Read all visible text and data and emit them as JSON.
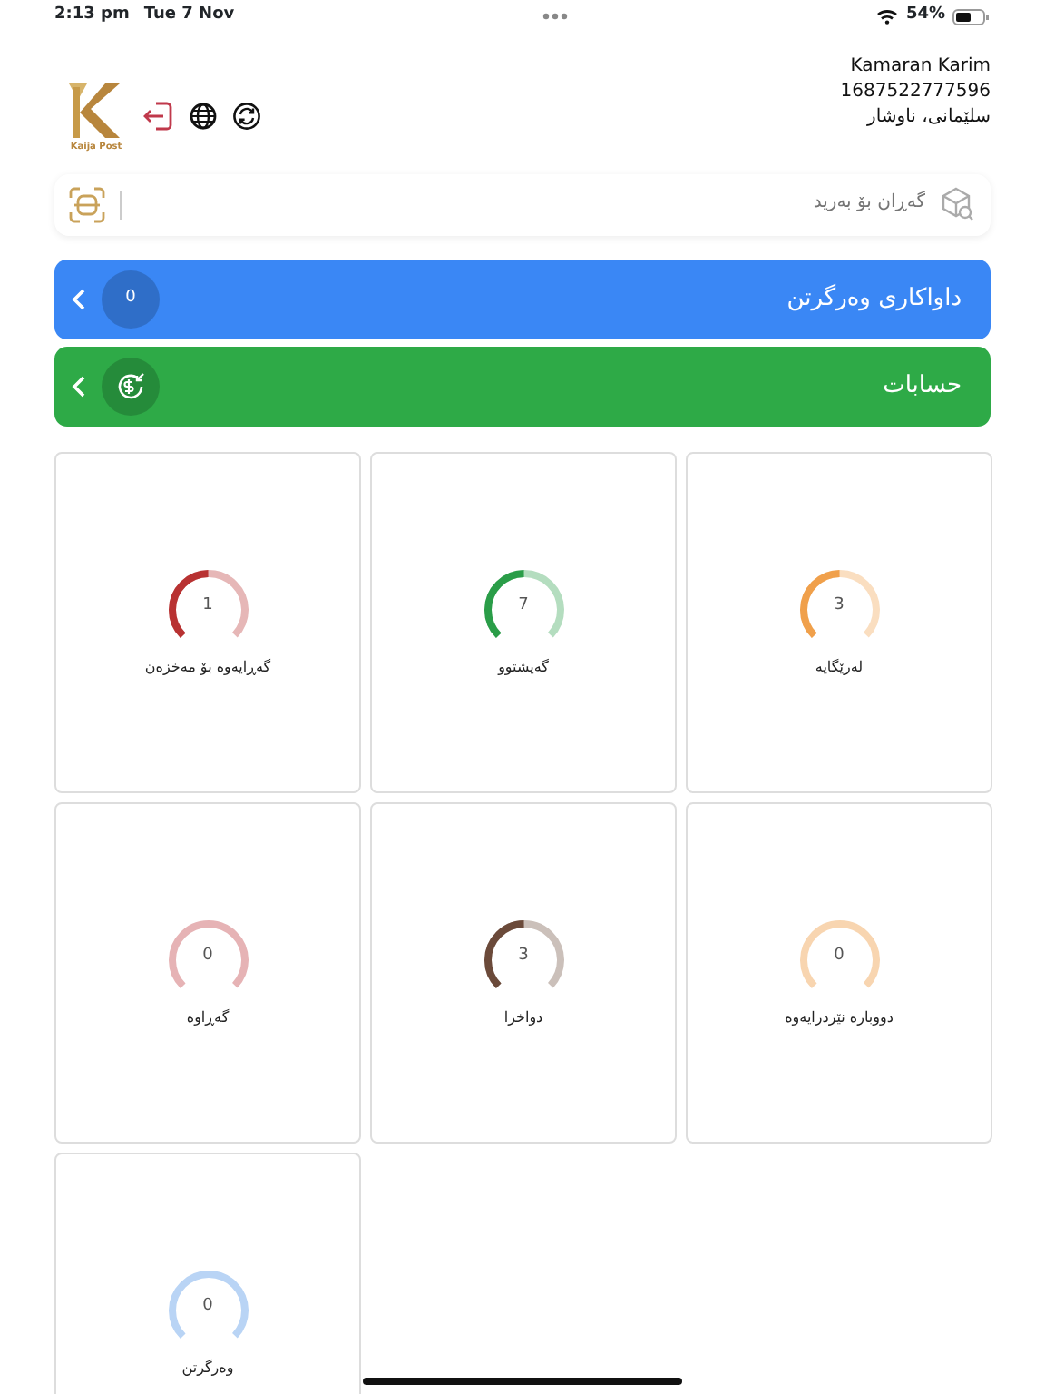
{
  "status_bar": {
    "time": "2:13 pm",
    "date": "Tue 7 Nov",
    "battery": "54%"
  },
  "header": {
    "logo_text": "Kaija Post",
    "user_name": "Kamaran Karim",
    "phone": "1687522777596",
    "location": "سلێمانی، ناوشار"
  },
  "search": {
    "placeholder": "گەڕان بۆ بەرید"
  },
  "banners": [
    {
      "kind": "count",
      "label": "داواکاری وەرگرتن",
      "count": "0",
      "color": "#3a87f5"
    },
    {
      "kind": "money",
      "label": "حسابات",
      "color": "#2eaa47"
    }
  ],
  "stats": [
    {
      "label": "لەرێگایە",
      "value": "3",
      "level": 0.5,
      "color": "#f0a04b"
    },
    {
      "label": "گەیشتوو",
      "value": "7",
      "level": 0.5,
      "color": "#2a9d48"
    },
    {
      "label": "گەڕایەوە بۆ مەخزەن",
      "value": "1",
      "level": 0.5,
      "color": "#b83232"
    },
    {
      "label": "دووبارە نێردرایەوە",
      "value": "0",
      "level": 0,
      "color": "#f8d5b0"
    },
    {
      "label": "دواخرا",
      "value": "3",
      "level": 0.5,
      "color": "#6b4a3a"
    },
    {
      "label": "گەڕاوە",
      "value": "0",
      "level": 0,
      "color": "#e6b3b5"
    },
    {
      "label": "وەرگرتن",
      "value": "0",
      "level": 0,
      "color": "#b9d4f5"
    }
  ]
}
